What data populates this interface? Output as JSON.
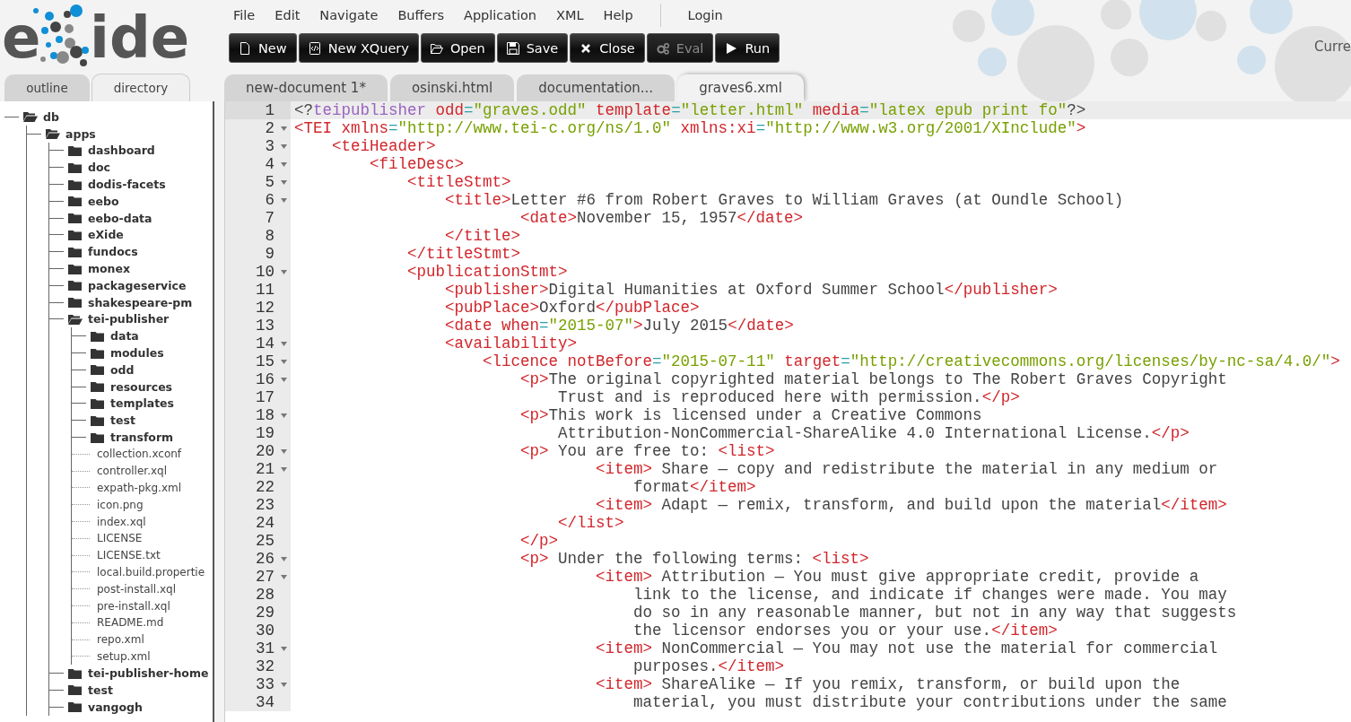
{
  "logo": {
    "text_start": "e",
    "text_end": "ide"
  },
  "menu": [
    "File",
    "Edit",
    "Navigate",
    "Buffers",
    "Application",
    "XML",
    "Help"
  ],
  "login": "Login",
  "toolbar": [
    {
      "label": "New",
      "disabled": false
    },
    {
      "label": "New XQuery",
      "disabled": false
    },
    {
      "label": "Open",
      "disabled": false
    },
    {
      "label": "Save",
      "disabled": false
    },
    {
      "label": "Close",
      "disabled": false
    },
    {
      "label": "Eval",
      "disabled": true
    },
    {
      "label": "Run",
      "disabled": false
    }
  ],
  "status_text": "Curre",
  "sidebar": {
    "tabs": [
      {
        "label": "outline",
        "selected": false
      },
      {
        "label": "directory",
        "selected": true
      }
    ]
  },
  "tree": [
    {
      "label": "db",
      "kind": "folder",
      "expanded": true,
      "children": [
        {
          "label": "apps",
          "kind": "folder",
          "expanded": true,
          "children": [
            {
              "label": "dashboard",
              "kind": "folder",
              "expanded": false
            },
            {
              "label": "doc",
              "kind": "folder",
              "expanded": false
            },
            {
              "label": "dodis-facets",
              "kind": "folder",
              "expanded": false
            },
            {
              "label": "eebo",
              "kind": "folder",
              "expanded": false
            },
            {
              "label": "eebo-data",
              "kind": "folder",
              "expanded": false
            },
            {
              "label": "eXide",
              "kind": "folder",
              "expanded": false
            },
            {
              "label": "fundocs",
              "kind": "folder",
              "expanded": false
            },
            {
              "label": "monex",
              "kind": "folder",
              "expanded": false
            },
            {
              "label": "packageservice",
              "kind": "folder",
              "expanded": false
            },
            {
              "label": "shakespeare-pm",
              "kind": "folder",
              "expanded": false
            },
            {
              "label": "tei-publisher",
              "kind": "folder",
              "expanded": true,
              "children": [
                {
                  "label": "data",
                  "kind": "folder",
                  "expanded": false
                },
                {
                  "label": "modules",
                  "kind": "folder",
                  "expanded": false
                },
                {
                  "label": "odd",
                  "kind": "folder",
                  "expanded": false
                },
                {
                  "label": "resources",
                  "kind": "folder",
                  "expanded": false
                },
                {
                  "label": "templates",
                  "kind": "folder",
                  "expanded": false
                },
                {
                  "label": "test",
                  "kind": "folder",
                  "expanded": false
                },
                {
                  "label": "transform",
                  "kind": "folder",
                  "expanded": false
                },
                {
                  "label": "collection.xconf",
                  "kind": "file"
                },
                {
                  "label": "controller.xql",
                  "kind": "file"
                },
                {
                  "label": "expath-pkg.xml",
                  "kind": "file"
                },
                {
                  "label": "icon.png",
                  "kind": "file"
                },
                {
                  "label": "index.xql",
                  "kind": "file"
                },
                {
                  "label": "LICENSE",
                  "kind": "file"
                },
                {
                  "label": "LICENSE.txt",
                  "kind": "file"
                },
                {
                  "label": "local.build.propertie",
                  "kind": "file"
                },
                {
                  "label": "post-install.xql",
                  "kind": "file"
                },
                {
                  "label": "pre-install.xql",
                  "kind": "file"
                },
                {
                  "label": "README.md",
                  "kind": "file"
                },
                {
                  "label": "repo.xml",
                  "kind": "file"
                },
                {
                  "label": "setup.xml",
                  "kind": "file"
                }
              ]
            },
            {
              "label": "tei-publisher-home",
              "kind": "folder",
              "expanded": false
            },
            {
              "label": "test",
              "kind": "folder",
              "expanded": false
            },
            {
              "label": "vangogh",
              "kind": "folder",
              "expanded": false
            }
          ]
        }
      ]
    }
  ],
  "editor_tabs": [
    {
      "label": "new-document 1*",
      "selected": false
    },
    {
      "label": "osinski.html",
      "selected": false
    },
    {
      "label": "documentation...",
      "selected": false
    },
    {
      "label": "graves6.xml",
      "selected": true
    }
  ],
  "code": {
    "lines": [
      {
        "number": "1",
        "foldable": false,
        "active": true,
        "tokens": [
          {
            "kind": "plain",
            "text": "<?"
          },
          {
            "kind": "pi",
            "text": "teipublisher"
          },
          {
            "kind": "attr",
            "text": " odd"
          },
          {
            "kind": "eq",
            "text": "="
          },
          {
            "kind": "value",
            "text": "\"graves.odd\""
          },
          {
            "kind": "attr",
            "text": " template"
          },
          {
            "kind": "eq",
            "text": "="
          },
          {
            "kind": "value",
            "text": "\"letter.html\""
          },
          {
            "kind": "attr",
            "text": " media"
          },
          {
            "kind": "eq",
            "text": "="
          },
          {
            "kind": "value",
            "text": "\"latex epub print fo\""
          },
          {
            "kind": "plain",
            "text": "?>"
          }
        ]
      },
      {
        "number": "2",
        "foldable": true,
        "active": false,
        "tokens": [
          {
            "kind": "tag",
            "text": "<TEI"
          },
          {
            "kind": "attr",
            "text": " xmlns"
          },
          {
            "kind": "eq",
            "text": "="
          },
          {
            "kind": "value",
            "text": "\"http://www.tei-c.org/ns/1.0\""
          },
          {
            "kind": "attr",
            "text": " xmlns:xi"
          },
          {
            "kind": "eq",
            "text": "="
          },
          {
            "kind": "value",
            "text": "\"http://www.w3.org/2001/XInclude\""
          },
          {
            "kind": "tag",
            "text": ">"
          }
        ]
      },
      {
        "number": "3",
        "foldable": true,
        "active": false,
        "tokens": [
          {
            "kind": "tag",
            "text": "    <teiHeader>"
          }
        ]
      },
      {
        "number": "4",
        "foldable": true,
        "active": false,
        "tokens": [
          {
            "kind": "tag",
            "text": "        <fileDesc>"
          }
        ]
      },
      {
        "number": "5",
        "foldable": true,
        "active": false,
        "tokens": [
          {
            "kind": "tag",
            "text": "            <titleStmt>"
          }
        ]
      },
      {
        "number": "6",
        "foldable": true,
        "active": false,
        "tokens": [
          {
            "kind": "tag",
            "text": "                <title>"
          },
          {
            "kind": "plain",
            "text": "Letter #6 from Robert Graves to William Graves (at Oundle School)"
          }
        ]
      },
      {
        "number": "7",
        "foldable": false,
        "active": false,
        "tokens": [
          {
            "kind": "tag",
            "text": "                        <date>"
          },
          {
            "kind": "plain",
            "text": "November 15, 1957"
          },
          {
            "kind": "tag",
            "text": "</date>"
          }
        ]
      },
      {
        "number": "8",
        "foldable": false,
        "active": false,
        "tokens": [
          {
            "kind": "tag",
            "text": "                </title>"
          }
        ]
      },
      {
        "number": "9",
        "foldable": false,
        "active": false,
        "tokens": [
          {
            "kind": "tag",
            "text": "            </titleStmt>"
          }
        ]
      },
      {
        "number": "10",
        "foldable": true,
        "active": false,
        "tokens": [
          {
            "kind": "tag",
            "text": "            <publicationStmt>"
          }
        ]
      },
      {
        "number": "11",
        "foldable": false,
        "active": false,
        "tokens": [
          {
            "kind": "tag",
            "text": "                <publisher>"
          },
          {
            "kind": "plain",
            "text": "Digital Humanities at Oxford Summer School"
          },
          {
            "kind": "tag",
            "text": "</publisher>"
          }
        ]
      },
      {
        "number": "12",
        "foldable": false,
        "active": false,
        "tokens": [
          {
            "kind": "tag",
            "text": "                <pubPlace>"
          },
          {
            "kind": "plain",
            "text": "Oxford"
          },
          {
            "kind": "tag",
            "text": "</pubPlace>"
          }
        ]
      },
      {
        "number": "13",
        "foldable": false,
        "active": false,
        "tokens": [
          {
            "kind": "tag",
            "text": "                <date"
          },
          {
            "kind": "attr",
            "text": " when"
          },
          {
            "kind": "eq",
            "text": "="
          },
          {
            "kind": "value",
            "text": "\"2015-07\""
          },
          {
            "kind": "tag",
            "text": ">"
          },
          {
            "kind": "plain",
            "text": "July 2015"
          },
          {
            "kind": "tag",
            "text": "</date>"
          }
        ]
      },
      {
        "number": "14",
        "foldable": true,
        "active": false,
        "tokens": [
          {
            "kind": "tag",
            "text": "                <availability>"
          }
        ]
      },
      {
        "number": "15",
        "foldable": true,
        "active": false,
        "tokens": [
          {
            "kind": "tag",
            "text": "                    <licence"
          },
          {
            "kind": "attr",
            "text": " notBefore"
          },
          {
            "kind": "eq",
            "text": "="
          },
          {
            "kind": "value",
            "text": "\"2015-07-11\""
          },
          {
            "kind": "attr",
            "text": " target"
          },
          {
            "kind": "eq",
            "text": "="
          },
          {
            "kind": "value",
            "text": "\"http://creativecommons.org/licenses/by-nc-sa/4.0/\""
          },
          {
            "kind": "tag",
            "text": ">"
          }
        ]
      },
      {
        "number": "16",
        "foldable": true,
        "active": false,
        "tokens": [
          {
            "kind": "tag",
            "text": "                        <p>"
          },
          {
            "kind": "plain",
            "text": "The original copyrighted material belongs to The Robert Graves Copyright"
          }
        ]
      },
      {
        "number": "17",
        "foldable": false,
        "active": false,
        "tokens": [
          {
            "kind": "plain",
            "text": "                            Trust and is reproduced here with permission."
          },
          {
            "kind": "tag",
            "text": "</p>"
          }
        ]
      },
      {
        "number": "18",
        "foldable": true,
        "active": false,
        "tokens": [
          {
            "kind": "tag",
            "text": "                        <p>"
          },
          {
            "kind": "plain",
            "text": "This work is licensed under a Creative Commons"
          }
        ]
      },
      {
        "number": "19",
        "foldable": false,
        "active": false,
        "tokens": [
          {
            "kind": "plain",
            "text": "                            Attribution-NonCommercial-ShareAlike 4.0 International License."
          },
          {
            "kind": "tag",
            "text": "</p>"
          }
        ]
      },
      {
        "number": "20",
        "foldable": true,
        "active": false,
        "tokens": [
          {
            "kind": "tag",
            "text": "                        <p>"
          },
          {
            "kind": "plain",
            "text": " You are free to: "
          },
          {
            "kind": "tag",
            "text": "<list>"
          }
        ]
      },
      {
        "number": "21",
        "foldable": true,
        "active": false,
        "tokens": [
          {
            "kind": "tag",
            "text": "                                <item>"
          },
          {
            "kind": "plain",
            "text": " Share — copy and redistribute the material in any medium or"
          }
        ]
      },
      {
        "number": "22",
        "foldable": false,
        "active": false,
        "tokens": [
          {
            "kind": "plain",
            "text": "                                    format"
          },
          {
            "kind": "tag",
            "text": "</item>"
          }
        ]
      },
      {
        "number": "23",
        "foldable": false,
        "active": false,
        "tokens": [
          {
            "kind": "tag",
            "text": "                                <item>"
          },
          {
            "kind": "plain",
            "text": " Adapt — remix, transform, and build upon the material"
          },
          {
            "kind": "tag",
            "text": "</item>"
          }
        ]
      },
      {
        "number": "24",
        "foldable": false,
        "active": false,
        "tokens": [
          {
            "kind": "tag",
            "text": "                            </list>"
          }
        ]
      },
      {
        "number": "25",
        "foldable": false,
        "active": false,
        "tokens": [
          {
            "kind": "tag",
            "text": "                        </p>"
          }
        ]
      },
      {
        "number": "26",
        "foldable": true,
        "active": false,
        "tokens": [
          {
            "kind": "tag",
            "text": "                        <p>"
          },
          {
            "kind": "plain",
            "text": " Under the following terms: "
          },
          {
            "kind": "tag",
            "text": "<list>"
          }
        ]
      },
      {
        "number": "27",
        "foldable": true,
        "active": false,
        "tokens": [
          {
            "kind": "tag",
            "text": "                                <item>"
          },
          {
            "kind": "plain",
            "text": " Attribution — You must give appropriate credit, provide a"
          }
        ]
      },
      {
        "number": "28",
        "foldable": false,
        "active": false,
        "tokens": [
          {
            "kind": "plain",
            "text": "                                    link to the license, and indicate if changes were made. You may"
          }
        ]
      },
      {
        "number": "29",
        "foldable": false,
        "active": false,
        "tokens": [
          {
            "kind": "plain",
            "text": "                                    do so in any reasonable manner, but not in any way that suggests"
          }
        ]
      },
      {
        "number": "30",
        "foldable": false,
        "active": false,
        "tokens": [
          {
            "kind": "plain",
            "text": "                                    the licensor endorses you or your use."
          },
          {
            "kind": "tag",
            "text": "</item>"
          }
        ]
      },
      {
        "number": "31",
        "foldable": true,
        "active": false,
        "tokens": [
          {
            "kind": "tag",
            "text": "                                <item>"
          },
          {
            "kind": "plain",
            "text": " NonCommercial — You may not use the material for commercial"
          }
        ]
      },
      {
        "number": "32",
        "foldable": false,
        "active": false,
        "tokens": [
          {
            "kind": "plain",
            "text": "                                    purposes."
          },
          {
            "kind": "tag",
            "text": "</item>"
          }
        ]
      },
      {
        "number": "33",
        "foldable": true,
        "active": false,
        "tokens": [
          {
            "kind": "tag",
            "text": "                                <item>"
          },
          {
            "kind": "plain",
            "text": " ShareAlike — If you remix, transform, or build upon the"
          }
        ]
      },
      {
        "number": "34",
        "foldable": false,
        "active": false,
        "tokens": [
          {
            "kind": "plain",
            "text": "                                    material, you must distribute your contributions under the same"
          }
        ]
      }
    ]
  }
}
